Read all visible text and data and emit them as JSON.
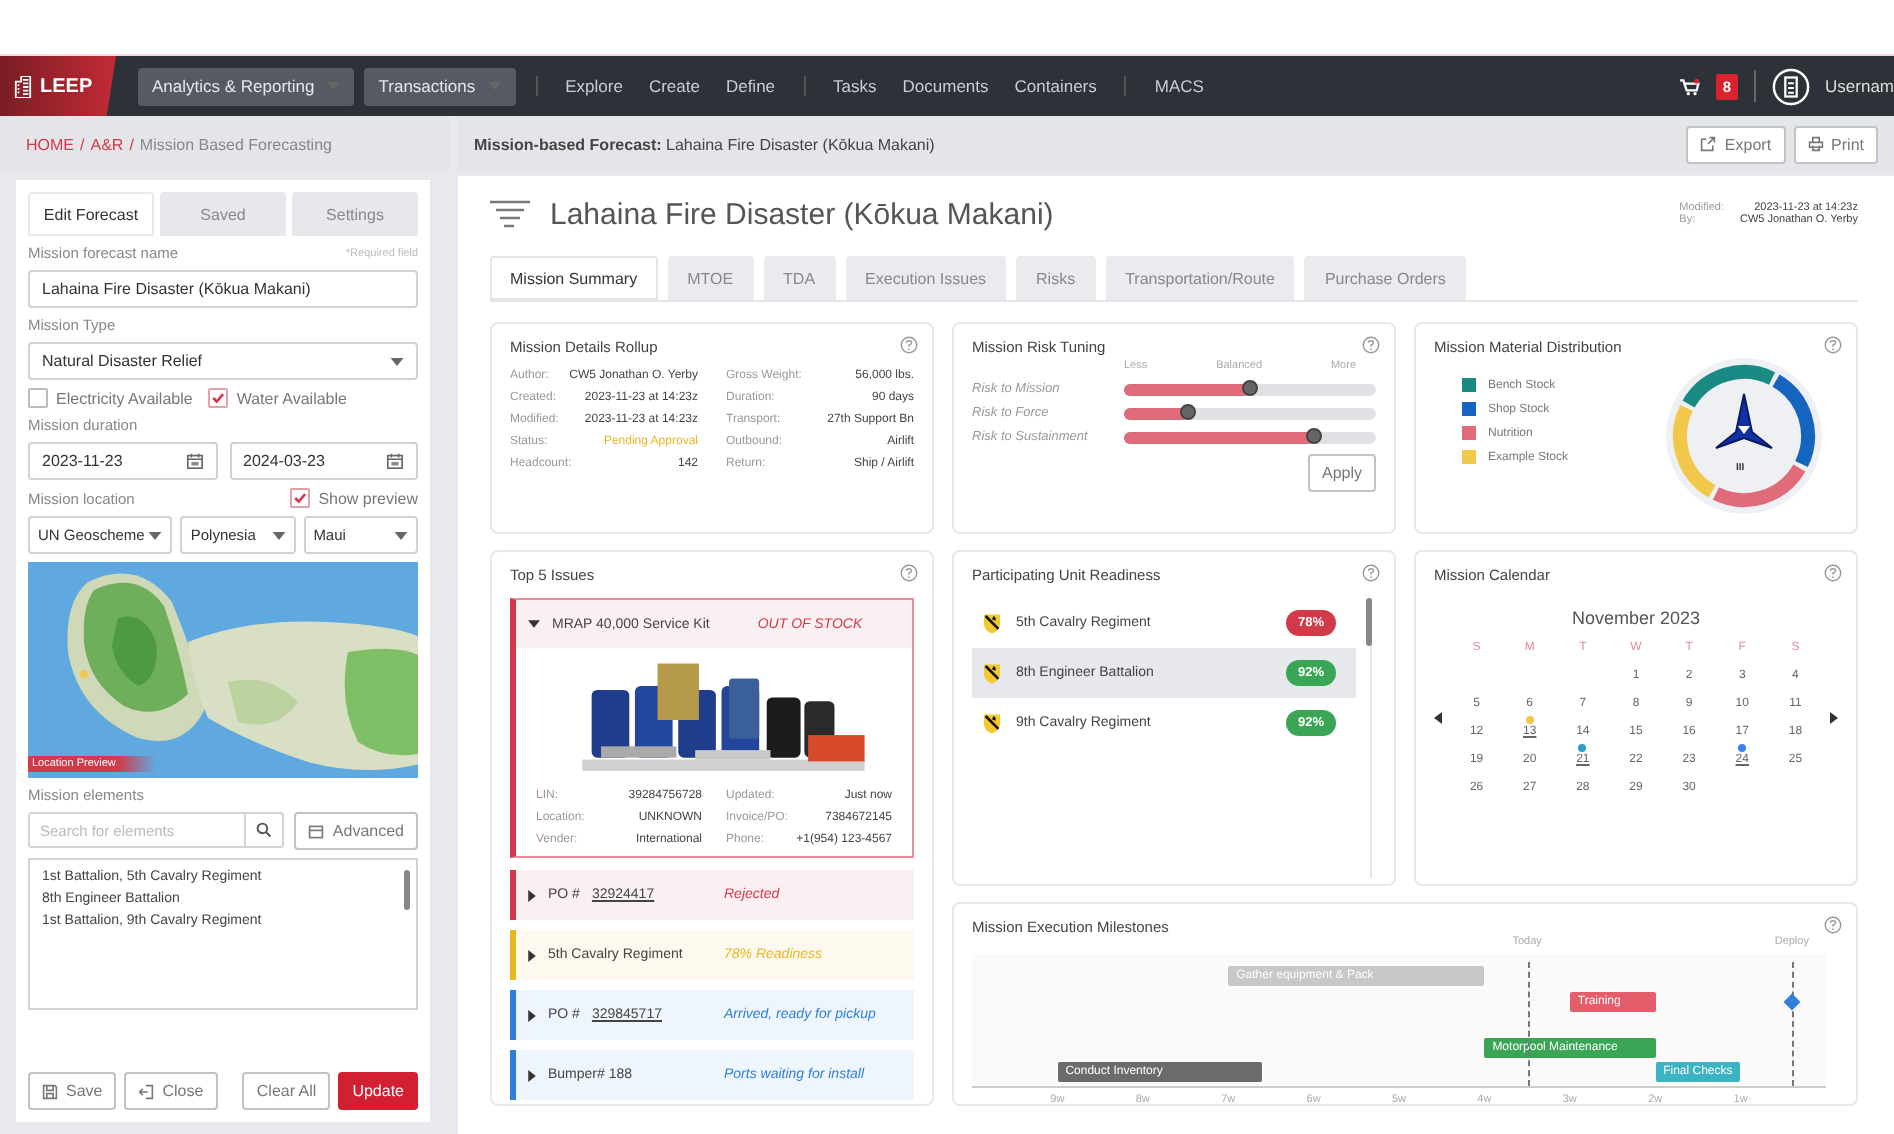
{
  "top_nav": {
    "logo": "LEEP",
    "groups": [
      {
        "items": [
          {
            "label": "Analytics & Reporting",
            "kind": "dropdown"
          },
          {
            "label": "Transactions",
            "kind": "dropdown"
          }
        ]
      },
      {
        "items": [
          {
            "label": "Explore",
            "kind": "link"
          },
          {
            "label": "Create",
            "kind": "link"
          },
          {
            "label": "Define",
            "kind": "link"
          }
        ]
      },
      {
        "items": [
          {
            "label": "Tasks",
            "kind": "link"
          },
          {
            "label": "Documents",
            "kind": "link"
          },
          {
            "label": "Containers",
            "kind": "link"
          }
        ]
      },
      {
        "items": [
          {
            "label": "MACS",
            "kind": "link"
          }
        ]
      }
    ],
    "cart_count": "8",
    "user": "Usernam"
  },
  "breadcrumb": {
    "separator": "/",
    "items": [
      {
        "label": "HOME",
        "link": true
      },
      {
        "label": "A&R",
        "link": true
      },
      {
        "label": "Mission Based Forecasting",
        "link": false
      }
    ]
  },
  "left_panel": {
    "tabs": [
      {
        "label": "Edit Forecast",
        "selected": true
      },
      {
        "label": "Saved",
        "selected": false
      },
      {
        "label": "Settings",
        "selected": false
      }
    ],
    "name_label": "Mission forecast name",
    "required_note": "*Required field",
    "name_value": "Lahaina Fire Disaster (Kōkua Makani)",
    "type_label": "Mission Type",
    "type_value": "Natural Disaster Relief",
    "options": [
      {
        "label": "Electricity Available",
        "checked": false
      },
      {
        "label": "Water Available",
        "checked": true
      }
    ],
    "duration_label": "Mission duration",
    "start_date": "2023-11-23",
    "end_date": "2024-03-23",
    "location_label": "Mission location",
    "show_preview": {
      "label": "Show preview",
      "checked": true
    },
    "location_selects": [
      "UN Geoscheme",
      "Polynesia",
      "Maui"
    ],
    "map_label": "Location Preview",
    "elements_label": "Mission elements",
    "search": {
      "placeholder": "Search for elements"
    },
    "advanced_button": "Advanced",
    "elements": [
      "1st Battalion, 5th Cavalry Regiment",
      "8th Engineer Battalion",
      "1st Battalion, 9th Cavalry Regiment"
    ],
    "buttons": [
      {
        "label": "Save",
        "kind": "save"
      },
      {
        "label": "Close",
        "kind": "close"
      },
      {
        "label": "Clear All",
        "kind": "plain"
      },
      {
        "label": "Update",
        "kind": "primary"
      }
    ]
  },
  "main": {
    "header": "**Mission-based Forecast:** Lahaina Fire Disaster (Kōkua Makani)",
    "actions": [
      {
        "label": "Export",
        "kind": "export"
      },
      {
        "label": "Print",
        "kind": "print"
      }
    ],
    "title": "Lahaina Fire Disaster (Kōkua Makani)",
    "meta": [
      {
        "label": "Modified:",
        "value": "2023-11-23 at 14:23z"
      },
      {
        "label": "By:",
        "value": "CW5 Jonathan O. Yerby"
      }
    ],
    "tabs": [
      {
        "label": "Mission Summary",
        "selected": true
      },
      {
        "label": "MTOE",
        "selected": false
      },
      {
        "label": "TDA",
        "selected": false
      },
      {
        "label": "Execution Issues",
        "selected": false
      },
      {
        "label": "Risks",
        "selected": false
      },
      {
        "label": "Transportation/Route",
        "selected": false
      },
      {
        "label": "Purchase Orders",
        "selected": false
      }
    ]
  },
  "details": {
    "title": "Mission Details Rollup",
    "columns": [
      [
        {
          "label": "Author:",
          "value": "CW5 Jonathan O. Yerby",
          "highlighted": false
        },
        {
          "label": "Created:",
          "value": "2023-11-23 at 14:23z",
          "highlighted": false
        },
        {
          "label": "Modified:",
          "value": "2023-11-23 at 14:23z",
          "highlighted": false
        },
        {
          "label": "Status:",
          "value": "Pending Approval",
          "highlighted": true
        },
        {
          "label": "Headcount:",
          "value": "142",
          "highlighted": false
        }
      ],
      [
        {
          "label": "Gross Weight:",
          "value": "56,000 lbs.",
          "highlighted": false
        },
        {
          "label": "Duration:",
          "value": "90 days",
          "highlighted": false
        },
        {
          "label": "Transport:",
          "value": "27th Support Bn",
          "highlighted": false
        },
        {
          "label": "Outbound:",
          "value": "Airlift",
          "highlighted": false
        },
        {
          "label": "Return:",
          "value": "Ship / Airlift",
          "highlighted": false
        }
      ]
    ]
  },
  "risk": {
    "title": "Mission Risk Tuning",
    "scale": [
      "Less",
      "Balanced",
      "More"
    ],
    "sliders": [
      {
        "label": "Risk to Mission",
        "level": 0.5
      },
      {
        "label": "Risk to Force",
        "level": 0.25
      },
      {
        "label": "Risk to Sustainment",
        "level": 0.75
      }
    ],
    "apply_button": "Apply"
  },
  "distribution": {
    "title": "Mission Material Distribution",
    "legend": [
      {
        "label": "Bench Stock",
        "color": "#1a8a84"
      },
      {
        "label": "Shop Stock",
        "color": "#1565c0"
      },
      {
        "label": "Nutrition",
        "color": "#e06b7a"
      },
      {
        "label": "Example Stock",
        "color": "#f2c84b"
      }
    ],
    "emblem_text": "III"
  },
  "issues": {
    "title": "Top 5 Issues",
    "items": [
      {
        "title": "MRAP 40,000 Service Kit",
        "status": "OUT OF STOCK",
        "color": "#d23a4a",
        "expanded": true,
        "details": [
          {
            "label": "LIN:",
            "value": "39284756728"
          },
          {
            "label": "Updated:",
            "value": "Just now"
          },
          {
            "label": "Location:",
            "value": "UNKNOWN"
          },
          {
            "label": "Invoice/PO:",
            "value": "7384672145"
          },
          {
            "label": "Vender:",
            "value": "International"
          },
          {
            "label": "Phone:",
            "value": "+1(954) 123-4567"
          }
        ]
      },
      {
        "prefix": "PO #",
        "link": "32924417",
        "status": "Rejected",
        "color": "#d23a4a",
        "expanded": false
      },
      {
        "title": "5th Cavalry Regiment",
        "status": "78% Readiness",
        "color": "#e8b622",
        "expanded": false
      },
      {
        "prefix": "PO #",
        "link": "329845717",
        "status": "Arrived, ready for pickup",
        "color": "#2f7fd8",
        "expanded": false
      },
      {
        "title": "Bumper# 188",
        "status": "Ports waiting for install",
        "color": "#2f7fd8",
        "expanded": false
      }
    ]
  },
  "readiness": {
    "title": "Participating Unit Readiness",
    "units": [
      {
        "name": "5th Cavalry Regiment",
        "percent": "78%",
        "color": "#d23a4a",
        "selected": false
      },
      {
        "name": "8th Engineer Battalion",
        "percent": "92%",
        "color": "#3aa655",
        "selected": true
      },
      {
        "name": "9th Cavalry Regiment",
        "percent": "92%",
        "color": "#3aa655",
        "selected": false
      }
    ]
  },
  "calendar": {
    "title": "Mission Calendar",
    "month": "November 2023",
    "weekdays": [
      "S",
      "M",
      "T",
      "W",
      "T",
      "F",
      "S"
    ],
    "weeks": [
      {
        "days": [
          {
            "label": "1"
          },
          {
            "label": "2"
          },
          {
            "label": "3"
          },
          {
            "label": "4"
          }
        ]
      },
      {
        "days": [
          {
            "label": "5"
          },
          {
            "label": "6"
          },
          {
            "label": "7"
          },
          {
            "label": "8"
          },
          {
            "label": "9"
          },
          {
            "label": "10"
          },
          {
            "label": "11"
          }
        ]
      },
      {
        "days": [
          {
            "label": "12"
          },
          {
            "label": "13",
            "color": "#f2c84b"
          },
          {
            "label": "14"
          },
          {
            "label": "15"
          },
          {
            "label": "16"
          },
          {
            "label": "17"
          },
          {
            "label": "18"
          }
        ]
      },
      {
        "days": [
          {
            "label": "19"
          },
          {
            "label": "20"
          },
          {
            "label": "21",
            "color": "#2a9fc9"
          },
          {
            "label": "22"
          },
          {
            "label": "23"
          },
          {
            "label": "24",
            "color": "#3b82f6"
          },
          {
            "label": "25"
          }
        ]
      },
      {
        "days": [
          {
            "label": "26"
          },
          {
            "label": "27"
          },
          {
            "label": "28"
          },
          {
            "label": "29"
          },
          {
            "label": "30"
          }
        ]
      }
    ]
  },
  "milestones": {
    "title": "Mission Execution Milestones",
    "markers": [
      "Today",
      "Deploy"
    ],
    "bars": [
      {
        "label": "Gather equipment & Pack",
        "color": "#c8c8c8"
      },
      {
        "label": "Training",
        "color": "#e35d6a"
      },
      {
        "label": "Motorpool Maintenance",
        "color": "#3aa655"
      },
      {
        "label": "Conduct Inventory",
        "color": "#6b6b6b"
      },
      {
        "label": "Final Checks",
        "color": "#3bb3c3"
      }
    ],
    "axis_labels": [
      "9w",
      "8w",
      "7w",
      "6w",
      "5w",
      "4w",
      "3w",
      "2w",
      "1w"
    ]
  }
}
